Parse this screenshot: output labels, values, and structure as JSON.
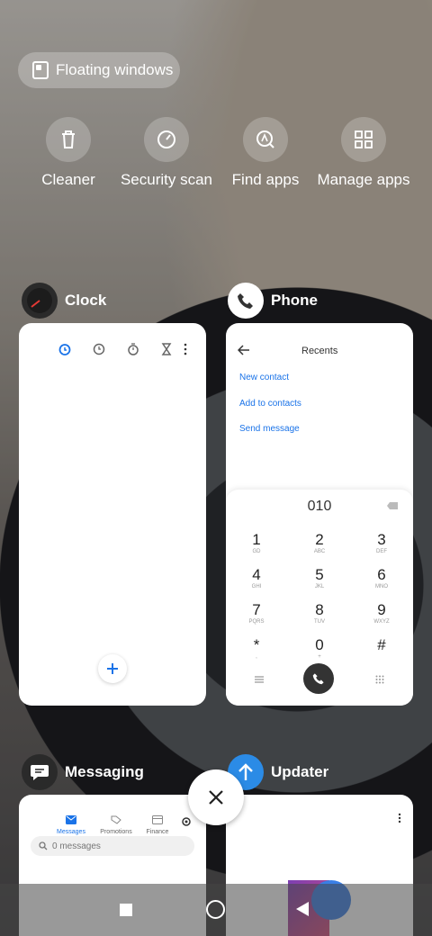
{
  "floating_windows": {
    "label": "Floating windows"
  },
  "actions": [
    {
      "label": "Cleaner",
      "icon": "trash-icon"
    },
    {
      "label": "Security scan",
      "icon": "shield-scan-icon"
    },
    {
      "label": "Find apps",
      "icon": "find-apps-icon"
    },
    {
      "label": "Manage apps",
      "icon": "grid-icon"
    }
  ],
  "apps": {
    "clock": {
      "name": "Clock",
      "icon": "clock-icon"
    },
    "phone": {
      "name": "Phone",
      "icon": "phone-icon",
      "header": "Recents",
      "links": [
        "New contact",
        "Add to contacts",
        "Send message"
      ],
      "dialed": "010",
      "keys": [
        {
          "d": "1",
          "s": "GD"
        },
        {
          "d": "2",
          "s": "ABC"
        },
        {
          "d": "3",
          "s": "DEF"
        },
        {
          "d": "4",
          "s": "GHI"
        },
        {
          "d": "5",
          "s": "JKL"
        },
        {
          "d": "6",
          "s": "MNO"
        },
        {
          "d": "7",
          "s": "PQRS"
        },
        {
          "d": "8",
          "s": "TUV"
        },
        {
          "d": "9",
          "s": "WXYZ"
        },
        {
          "d": "*",
          "s": ","
        },
        {
          "d": "0",
          "s": "+"
        },
        {
          "d": "#",
          "s": ""
        }
      ]
    },
    "messaging": {
      "name": "Messaging",
      "icon": "chat-icon",
      "tabs": [
        "Messages",
        "Promotions",
        "Finance"
      ],
      "search_placeholder": "0 messages"
    },
    "updater": {
      "name": "Updater",
      "icon": "arrow-up-icon"
    }
  },
  "colors": {
    "accent": "#1a73e8",
    "messaging_icon": "#2a2a2a",
    "updater_icon": "#2b8be6"
  }
}
